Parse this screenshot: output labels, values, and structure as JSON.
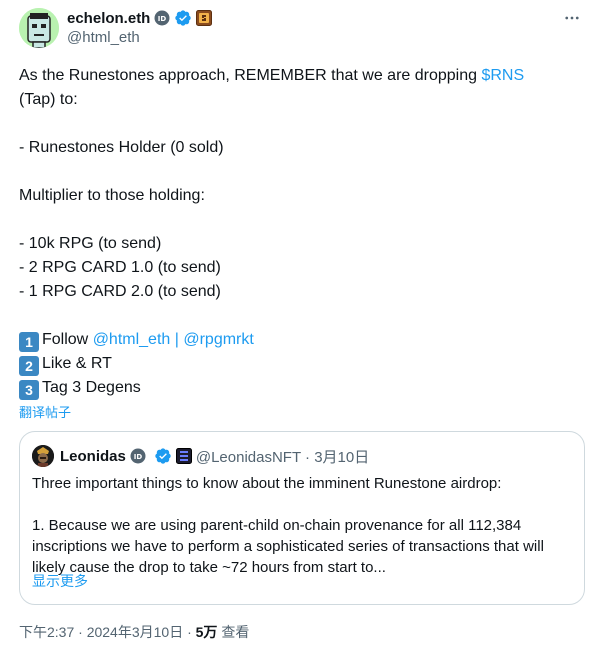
{
  "author": {
    "display_name": "echelon.eth",
    "handle": "@html_eth",
    "id_badge": "ID",
    "more_icon": "more-dots-icon"
  },
  "post": {
    "line1_a": "As the Runestones approach, REMEMBER that we are dropping ",
    "line1_link": "$RNS",
    "line2": "(Tap) to:",
    "line3": "- Runestones Holder (0 sold)",
    "line4": "Multiplier to those holding:",
    "line5": "- 10k RPG (to send)",
    "line6": "- 2 RPG CARD 1.0 (to send)",
    "line7": "- 1 RPG CARD 2.0 (to send)",
    "step1_num": "1",
    "step1_text": "Follow ",
    "step1_link1": "@html_eth",
    "step1_sep": " | ",
    "step1_link2": "@rpgmrkt",
    "step2_num": "2",
    "step2_text": "Like & RT",
    "step3_num": "3",
    "step3_text": "Tag 3 Degens",
    "translate": "翻译帖子"
  },
  "quote": {
    "name": "Leonidas",
    "id_badge": "ID",
    "handle_date": "@LeonidasNFT · 3月10日",
    "line1": "Three important things to know about the imminent Runestone airdrop:",
    "line2": "1. Because we are using parent-child on-chain provenance for all 112,384",
    "line3": "inscriptions we have to perform a sophisticated series of transactions that will",
    "line4": "likely cause the drop to take ~72 hours from start to...",
    "show_more": "显示更多"
  },
  "footer": {
    "time_date": "下午2:37 · 2024年3月10日 · ",
    "views": "5万",
    "views_label": " 查看"
  },
  "colors": {
    "link": "#1d9bf0",
    "verified": "#1d9bf0",
    "keycap": "#3b88c3",
    "muted": "#536471",
    "text": "#0f1419"
  }
}
